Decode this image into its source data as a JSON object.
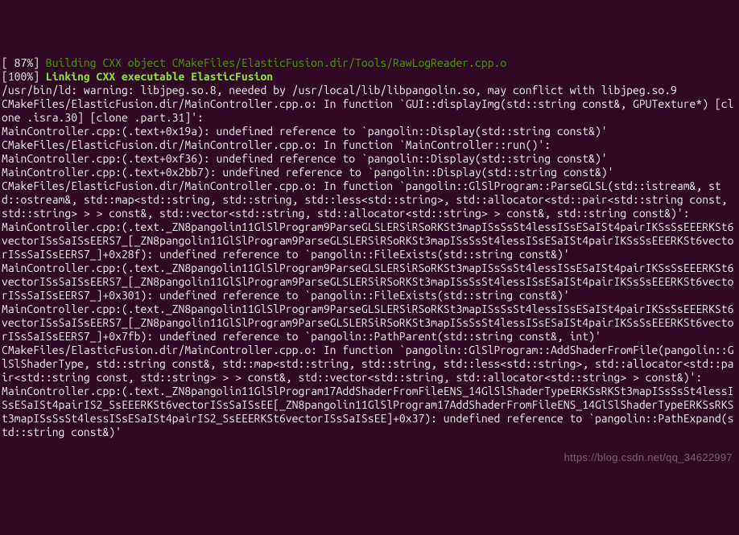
{
  "build": {
    "pct87": "[ 87%] ",
    "building": "Building CXX object CMakeFiles/ElasticFusion.dir/Tools/RawLogReader.cpp.o",
    "pct100": "[100%] ",
    "linking": "Linking CXX executable ElasticFusion"
  },
  "lines": [
    "/usr/bin/ld: warning: libjpeg.so.8, needed by /usr/local/lib/libpangolin.so, may conflict with libjpeg.so.9",
    "CMakeFiles/ElasticFusion.dir/MainController.cpp.o: In function `GUI::displayImg(std::string const&, GPUTexture*) [clone .isra.30] [clone .part.31]':",
    "MainController.cpp:(.text+0x19a): undefined reference to `pangolin::Display(std::string const&)'",
    "CMakeFiles/ElasticFusion.dir/MainController.cpp.o: In function `MainController::run()':",
    "MainController.cpp:(.text+0xf36): undefined reference to `pangolin::Display(std::string const&)'",
    "MainController.cpp:(.text+0x2bb7): undefined reference to `pangolin::Display(std::string const&)'",
    "CMakeFiles/ElasticFusion.dir/MainController.cpp.o: In function `pangolin::GlSlProgram::ParseGLSL(std::istream&, std::ostream&, std::map<std::string, std::string, std::less<std::string>, std::allocator<std::pair<std::string const, std::string> > > const&, std::vector<std::string, std::allocator<std::string> > const&, std::string const&)':",
    "MainController.cpp:(.text._ZN8pangolin11GlSlProgram9ParseGLSLERSiRSoRKSt3mapISsSsSt4lessISsESaISt4pairIKSsSsEEERKSt6vectorISsSaISsEERS7_[_ZN8pangolin11GlSlProgram9ParseGLSLERSiRSoRKSt3mapISsSsSt4lessISsESaISt4pairIKSsSsEEERKSt6vectorISsSaISsEERS7_]+0x28f): undefined reference to `pangolin::FileExists(std::string const&)'",
    "MainController.cpp:(.text._ZN8pangolin11GlSlProgram9ParseGLSLERSiRSoRKSt3mapISsSsSt4lessISsESaISt4pairIKSsSsEEERKSt6vectorISsSaISsEERS7_[_ZN8pangolin11GlSlProgram9ParseGLSLERSiRSoRKSt3mapISsSsSt4lessISsESaISt4pairIKSsSsEEERKSt6vectorISsSaISsEERS7_]+0x301): undefined reference to `pangolin::FileExists(std::string const&)'",
    "MainController.cpp:(.text._ZN8pangolin11GlSlProgram9ParseGLSLERSiRSoRKSt3mapISsSsSt4lessISsESaISt4pairIKSsSsEEERKSt6vectorISsSaISsEERS7_[_ZN8pangolin11GlSlProgram9ParseGLSLERSiRSoRKSt3mapISsSsSt4lessISsESaISt4pairIKSsSsEEERKSt6vectorISsSaISsEERS7_]+0x7fb): undefined reference to `pangolin::PathParent(std::string const&, int)'",
    "CMakeFiles/ElasticFusion.dir/MainController.cpp.o: In function `pangolin::GlSlProgram::AddShaderFromFile(pangolin::GlSlShaderType, std::string const&, std::map<std::string, std::string, std::less<std::string>, std::allocator<std::pair<std::string const, std::string> > > const&, std::vector<std::string, std::allocator<std::string> > const&)':",
    "MainController.cpp:(.text._ZN8pangolin11GlSlProgram17AddShaderFromFileENS_14GlSlShaderTypeERKSsRKSt3mapISsSsSt4lessISsESaISt4pairIS2_SsEEERKSt6vectorISsSaISsEE[_ZN8pangolin11GlSlProgram17AddShaderFromFileENS_14GlSlShaderTypeERKSsRKSt3mapISsSsSt4lessISsESaISt4pairIS2_SsEEERKSt6vectorISsSaISsEE]+0x37): undefined reference to `pangolin::PathExpand(std::string const&)'"
  ],
  "watermark": "https://blog.csdn.net/qq_34622997"
}
